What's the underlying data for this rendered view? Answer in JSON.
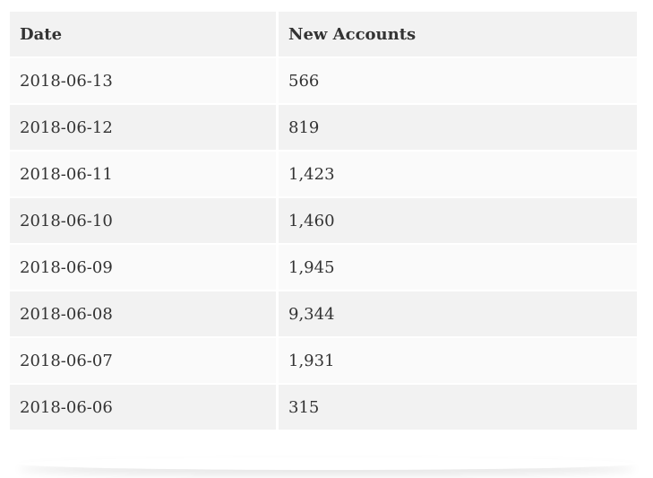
{
  "table": {
    "headers": [
      "Date",
      "New Accounts"
    ],
    "rows": [
      [
        "2018-06-13",
        "566"
      ],
      [
        "2018-06-12",
        "819"
      ],
      [
        "2018-06-11",
        "1,423"
      ],
      [
        "2018-06-10",
        "1,460"
      ],
      [
        "2018-06-09",
        "1,945"
      ],
      [
        "2018-06-08",
        "9,344"
      ],
      [
        "2018-06-07",
        "1,931"
      ],
      [
        "2018-06-06",
        "315"
      ]
    ]
  }
}
